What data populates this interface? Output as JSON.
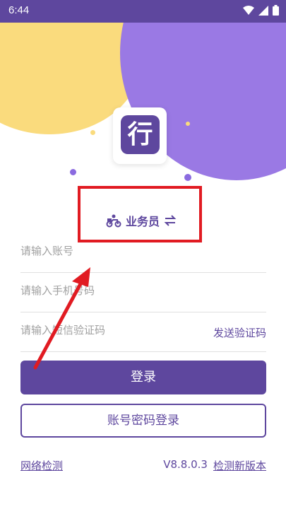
{
  "statusbar": {
    "time": "6:44"
  },
  "role": {
    "label": "业务员",
    "switch_icon": "swap-arrows-icon",
    "courier_icon": "scooter-icon"
  },
  "logo": {
    "char": "行"
  },
  "form": {
    "account_placeholder": "请输入账号",
    "phone_placeholder": "请输入手机号码",
    "sms_placeholder": "请输入短信验证码",
    "send_code": "发送验证码"
  },
  "buttons": {
    "login": "登录",
    "password_login": "账号密码登录"
  },
  "footer": {
    "network_check": "网络检测",
    "version": "V8.8.0.3",
    "check_update": "检测新版本"
  },
  "colors": {
    "primary": "#5e479e",
    "highlight": "#e11b22",
    "yellow": "#fadb7d",
    "purple": "#9a79e4"
  }
}
